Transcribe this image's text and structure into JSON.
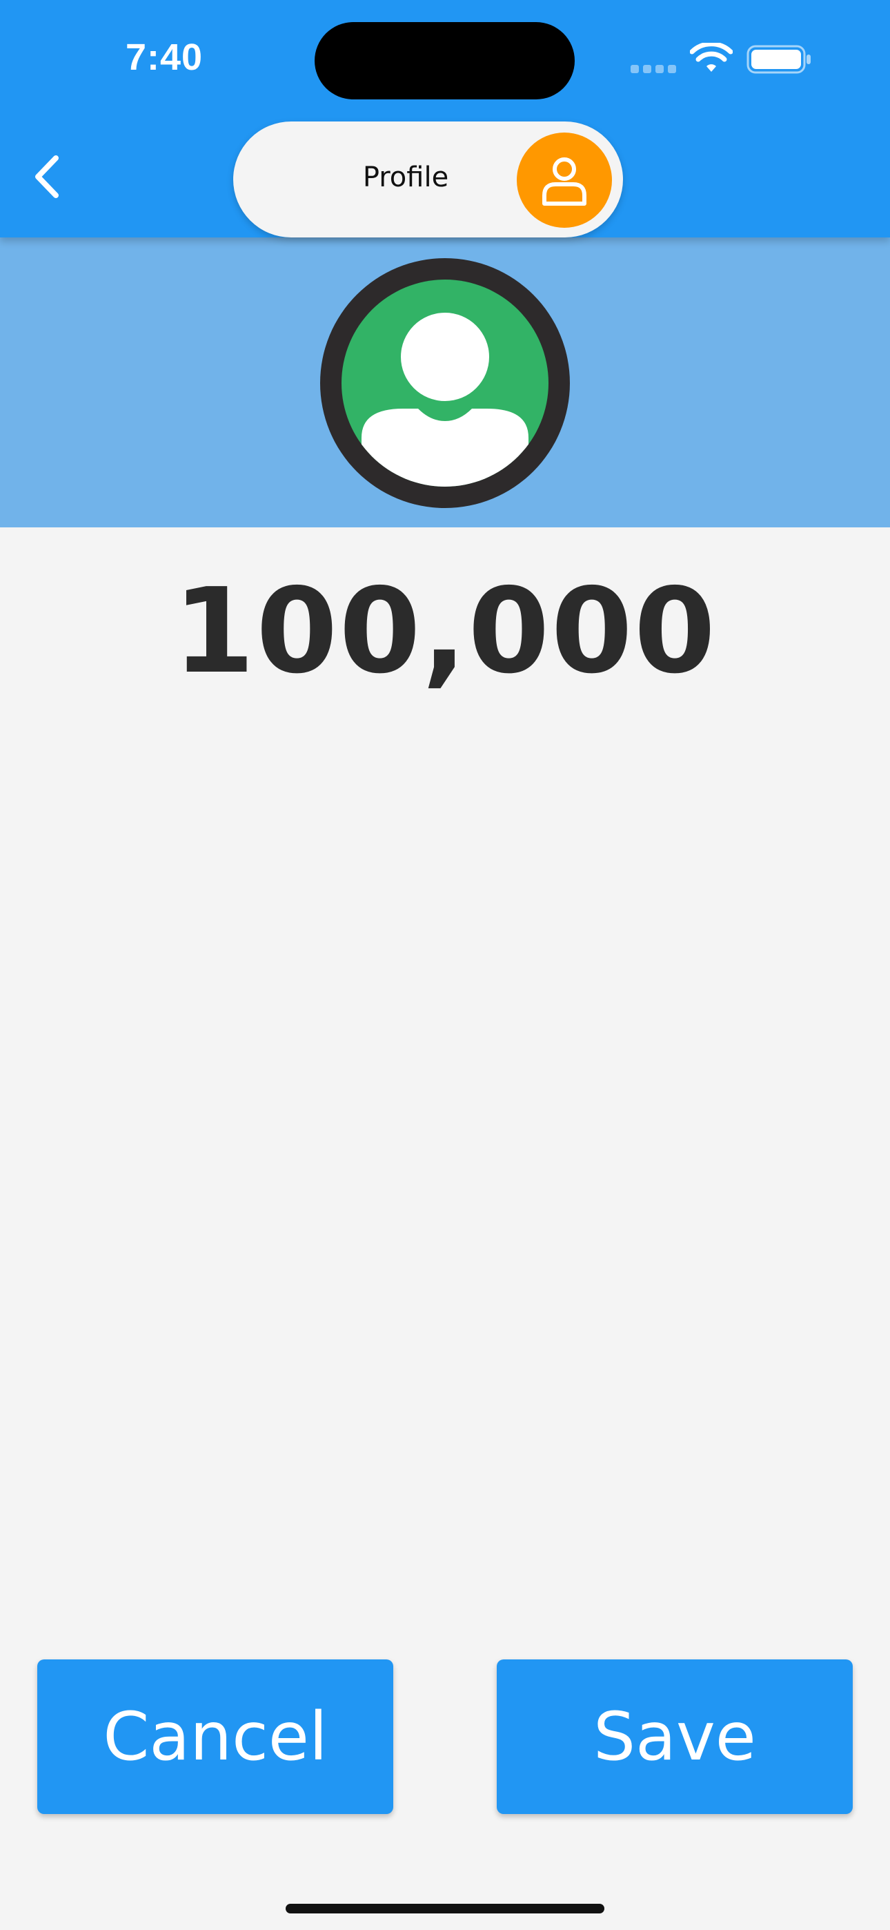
{
  "status_bar": {
    "time": "7:40",
    "icons": [
      "cellular-signal-icon",
      "wifi-icon",
      "battery-icon"
    ]
  },
  "app_bar": {
    "back_icon": "chevron-left-icon",
    "title": "Profile",
    "title_icon": "person-icon"
  },
  "profile": {
    "avatar_icon": "user-avatar-icon",
    "balance": "100,000"
  },
  "actions": {
    "cancel_label": "Cancel",
    "save_label": "Save"
  },
  "colors": {
    "primary": "#2196f3",
    "header_band": "#71b3ea",
    "accent": "#ff9800",
    "avatar_green": "#32b366",
    "avatar_ring": "#2d2a2b",
    "background": "#f4f4f4"
  }
}
